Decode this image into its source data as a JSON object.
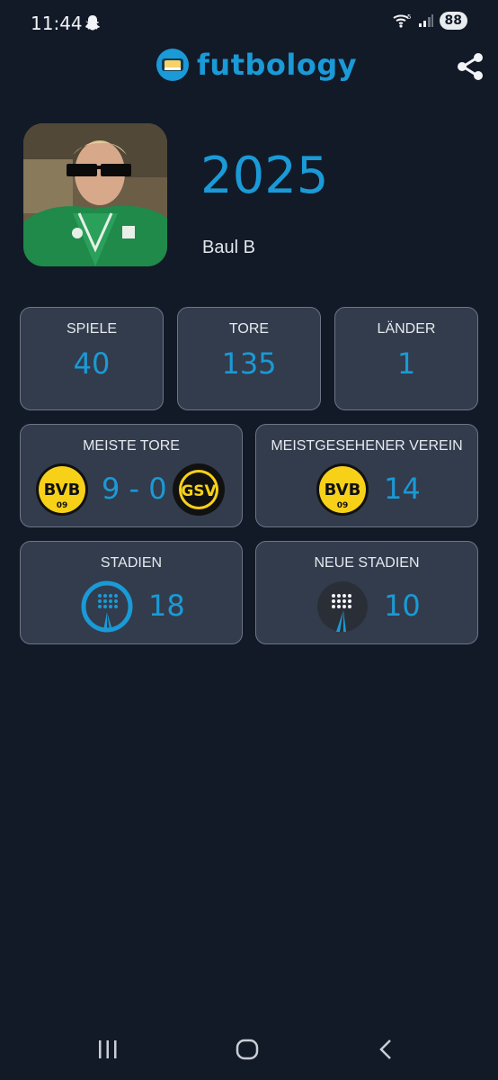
{
  "status_bar": {
    "time": "11:44",
    "network": "5",
    "battery": "88"
  },
  "app": {
    "name": "futbology"
  },
  "profile": {
    "year": "2025",
    "name": "Baul B"
  },
  "stats": [
    {
      "label": "SPIELE",
      "value": "40"
    },
    {
      "label": "TORE",
      "value": "135"
    },
    {
      "label": "LÄNDER",
      "value": "1"
    }
  ],
  "highlights": {
    "top_score": {
      "label": "MEISTE TORE",
      "score": "9 - 0",
      "home_club": "BVB 09",
      "away_club": "GSV"
    },
    "most_seen": {
      "label": "MEISTGESEHENER VEREIN",
      "value": "14",
      "club": "BVB 09"
    },
    "stadiums": {
      "label": "STADIEN",
      "value": "18"
    },
    "new_stadiums": {
      "label": "NEUE STADIEN",
      "value": "10"
    }
  },
  "colors": {
    "accent": "#1a9ad6",
    "background": "#121a28",
    "card": "#323c4d",
    "card_border": "#6c7686"
  },
  "icons": {
    "share": "share-icon",
    "recents": "recents-icon",
    "home": "home-icon",
    "back": "back-icon"
  }
}
